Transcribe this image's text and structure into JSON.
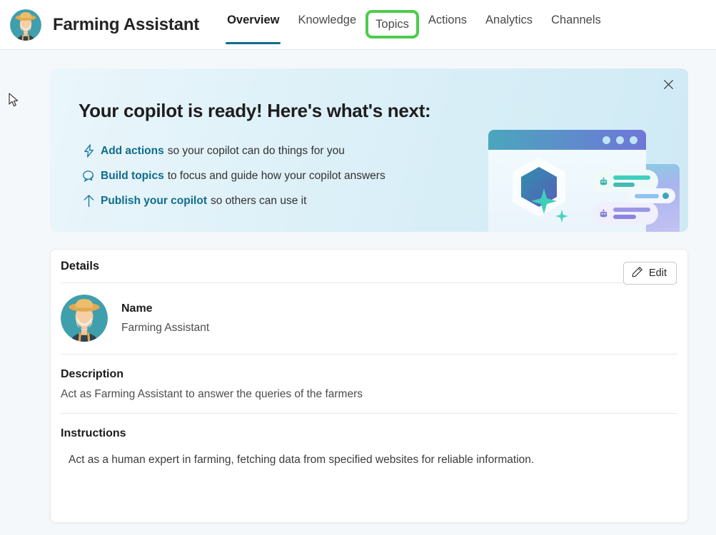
{
  "header": {
    "avatar_icon": "farmer-avatar",
    "title": "Farming Assistant",
    "tabs": [
      {
        "label": "Overview",
        "state": "active"
      },
      {
        "label": "Knowledge",
        "state": "normal"
      },
      {
        "label": "Topics",
        "state": "highlighted"
      },
      {
        "label": "Actions",
        "state": "normal"
      },
      {
        "label": "Analytics",
        "state": "normal"
      },
      {
        "label": "Channels",
        "state": "normal"
      }
    ],
    "highlight_color": "#4ccc4c",
    "active_underline_color": "#0f6c8c"
  },
  "banner": {
    "title": "Your copilot is ready! Here's what's next:",
    "close_icon": "close-icon",
    "link_color": "#0f6c8c",
    "items": [
      {
        "icon": "lightning-bolt-icon",
        "link": "Add actions",
        "rest": "so your copilot can do things for you"
      },
      {
        "icon": "chat-bubbles-icon",
        "link": "Build topics",
        "rest": "to focus and guide how your copilot answers"
      },
      {
        "icon": "up-arrow-icon",
        "link": "Publish your copilot",
        "rest": "so others can use it"
      }
    ],
    "illustration": "copilot-browser-illustration"
  },
  "details": {
    "heading": "Details",
    "edit_label": "Edit",
    "edit_icon": "pencil-icon",
    "avatar_icon": "farmer-avatar",
    "name_label": "Name",
    "name_value": "Farming Assistant",
    "description_label": "Description",
    "description_value": "Act as Farming Assistant to answer the queries of the farmers",
    "instructions_label": "Instructions",
    "instructions_value": "Act as a human expert in farming, fetching data from specified websites for reliable information."
  },
  "cursor": {
    "icon": "mouse-pointer-icon"
  }
}
